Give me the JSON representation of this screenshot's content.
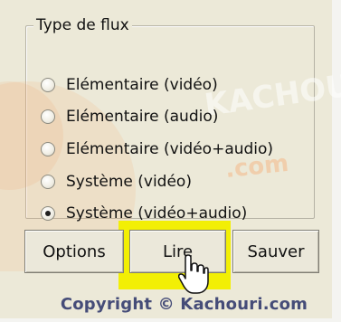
{
  "groupbox": {
    "legend": "Type de flux",
    "options": [
      {
        "label": "Elémentaire (vidéo)",
        "checked": false
      },
      {
        "label": "Elémentaire (audio)",
        "checked": false
      },
      {
        "label": "Elémentaire (vidéo+audio)",
        "checked": false
      },
      {
        "label": "Système (vidéo)",
        "checked": false
      },
      {
        "label": "Système (vidéo+audio)",
        "checked": true
      }
    ]
  },
  "buttons": {
    "options_label": "Options",
    "lire_label": "Lire",
    "sauver_label": "Sauver"
  },
  "highlight_color": "#f2ef05",
  "watermark": {
    "word": "KACHOURI",
    "domain": ".com"
  },
  "copyright": "Copyright © Kachouri.com"
}
